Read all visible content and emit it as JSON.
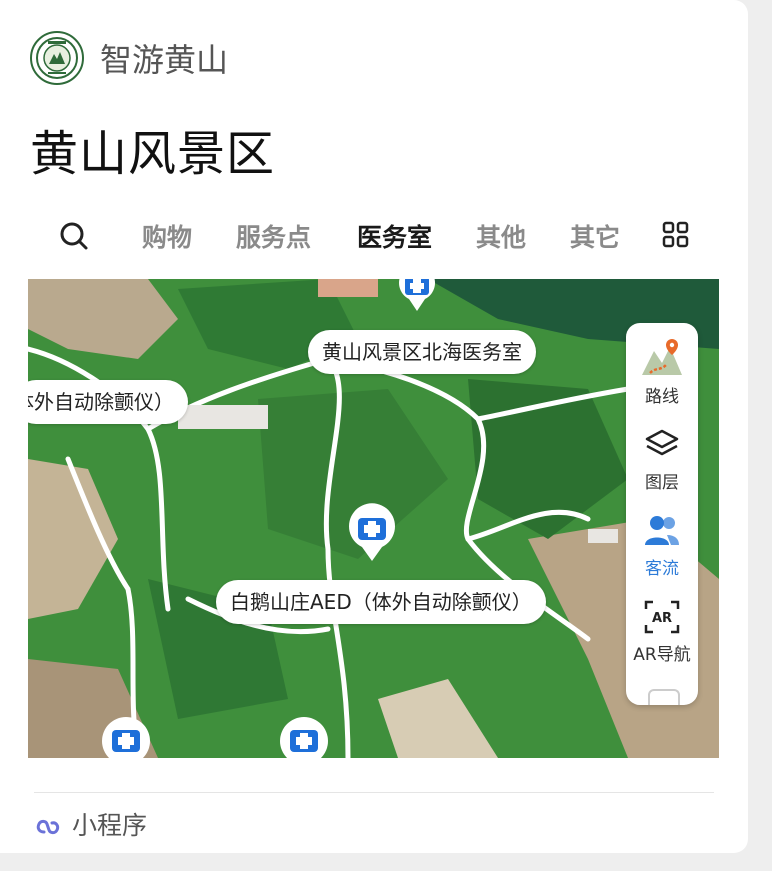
{
  "app": {
    "name": "智游黄山"
  },
  "page": {
    "title": "黄山风景区"
  },
  "tabs": [
    {
      "label": "购物"
    },
    {
      "label": "服务点"
    },
    {
      "label": "医务室",
      "active": true
    },
    {
      "label": "其他"
    },
    {
      "label": "其它"
    }
  ],
  "map": {
    "labels": {
      "north": "黄山风景区北海医务室",
      "left": "体外自动除颤仪）",
      "center": "白鹅山庄AED（体外自动除颤仪）"
    }
  },
  "tools": [
    {
      "label": "路线",
      "icon": "route-icon"
    },
    {
      "label": "图层",
      "icon": "layers-icon"
    },
    {
      "label": "客流",
      "icon": "visitor-flow-icon",
      "selected": true
    },
    {
      "label": "AR导航",
      "icon": "ar-icon",
      "badge": "AR"
    }
  ],
  "footer": {
    "label": "小程序"
  },
  "colors": {
    "accent": "#2d7bd8",
    "map_green": "#3d8b3a",
    "pin_blue": "#1e6fd9"
  }
}
